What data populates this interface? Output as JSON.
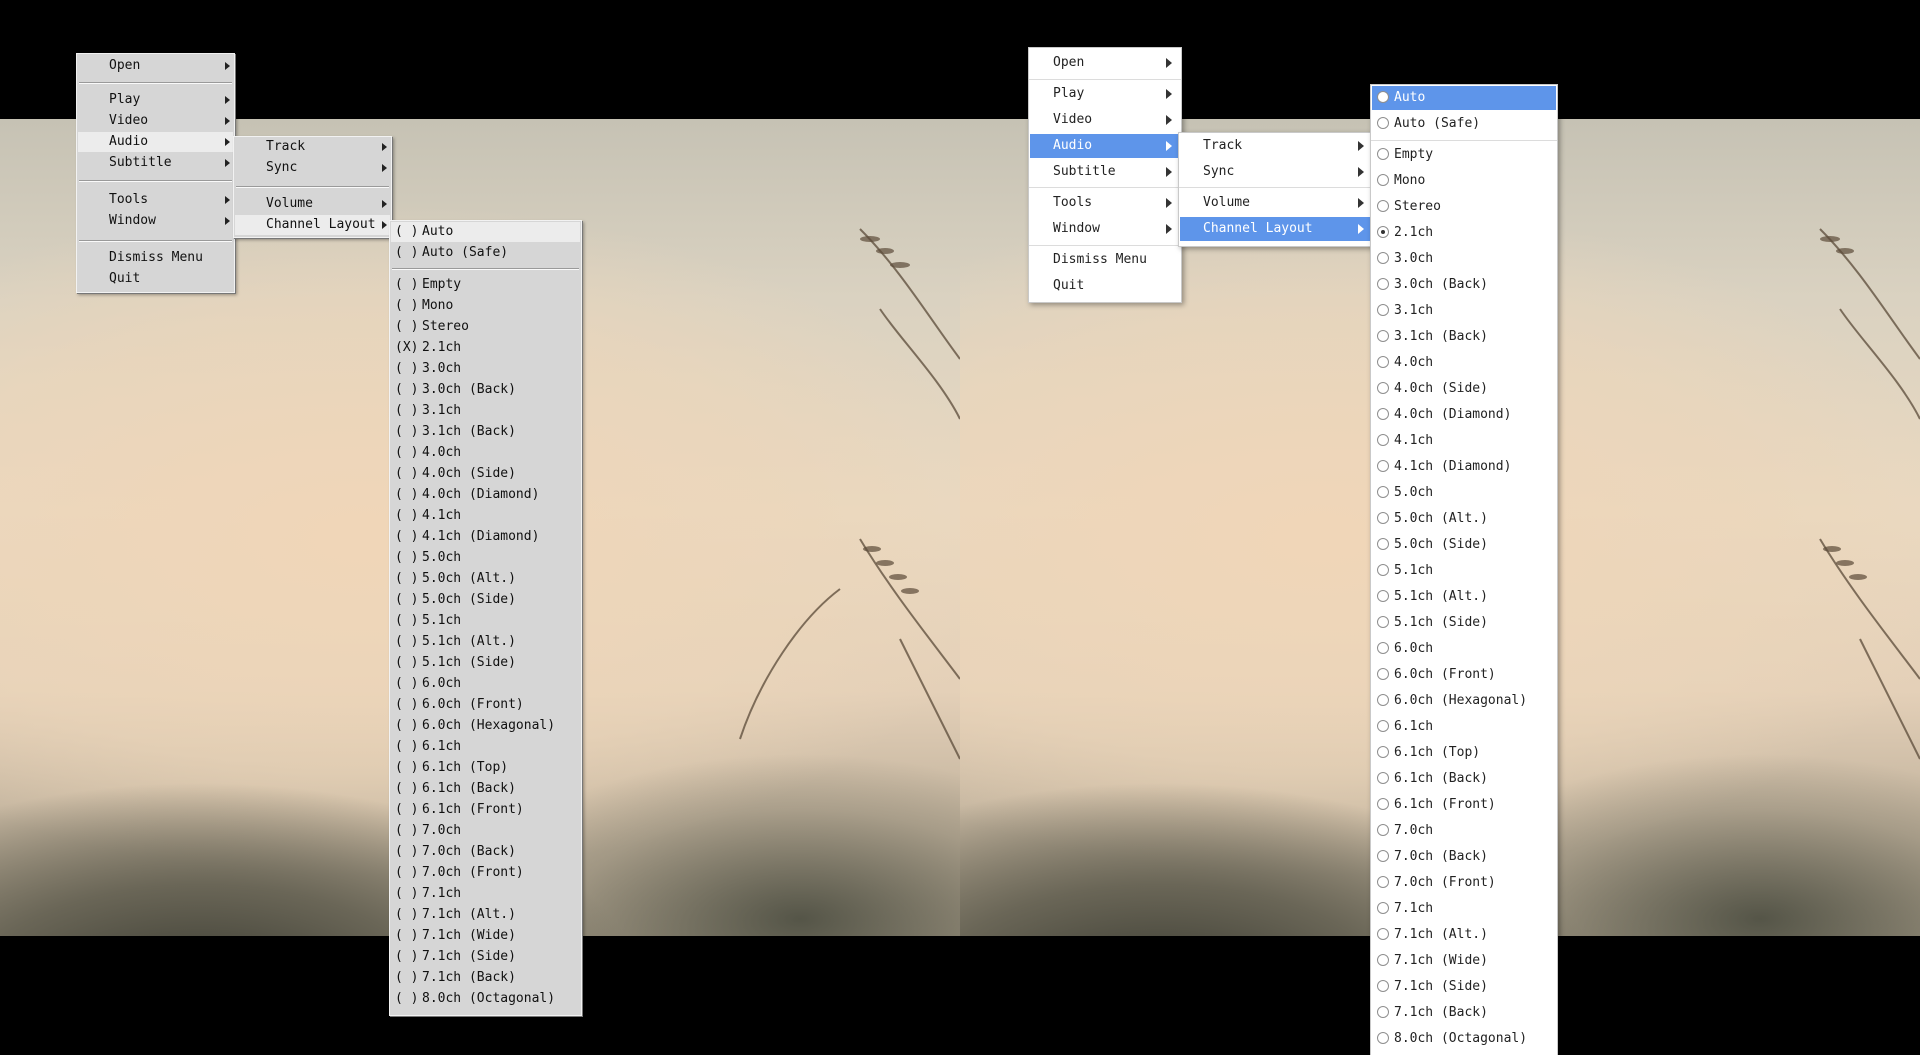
{
  "main_menu": {
    "open": "Open",
    "play": "Play",
    "video": "Video",
    "audio": "Audio",
    "subtitle": "Subtitle",
    "tools": "Tools",
    "window": "Window",
    "dismiss": "Dismiss Menu",
    "quit": "Quit"
  },
  "audio_menu": {
    "track": "Track",
    "sync": "Sync",
    "volume": "Volume",
    "channel_layout": "Channel Layout"
  },
  "channel_layouts": [
    "Auto",
    "Auto (Safe)",
    "Empty",
    "Mono",
    "Stereo",
    "2.1ch",
    "3.0ch",
    "3.0ch (Back)",
    "3.1ch",
    "3.1ch (Back)",
    "4.0ch",
    "4.0ch (Side)",
    "4.0ch (Diamond)",
    "4.1ch",
    "4.1ch (Diamond)",
    "5.0ch",
    "5.0ch (Alt.)",
    "5.0ch (Side)",
    "5.1ch",
    "5.1ch (Alt.)",
    "5.1ch (Side)",
    "6.0ch",
    "6.0ch (Front)",
    "6.0ch (Hexagonal)",
    "6.1ch",
    "6.1ch (Top)",
    "6.1ch (Back)",
    "6.1ch (Front)",
    "7.0ch",
    "7.0ch (Back)",
    "7.0ch (Front)",
    "7.1ch",
    "7.1ch (Alt.)",
    "7.1ch (Wide)",
    "7.1ch (Side)",
    "7.1ch (Back)",
    "8.0ch (Octagonal)"
  ],
  "selected_layout": "2.1ch",
  "radio_unchecked_prefix": "( )",
  "radio_checked_prefix": "(X)",
  "colors": {
    "highlight": "#5e95ea",
    "classic_menu_bg": "#d6d6d6",
    "modern_menu_bg": "#ffffff"
  }
}
